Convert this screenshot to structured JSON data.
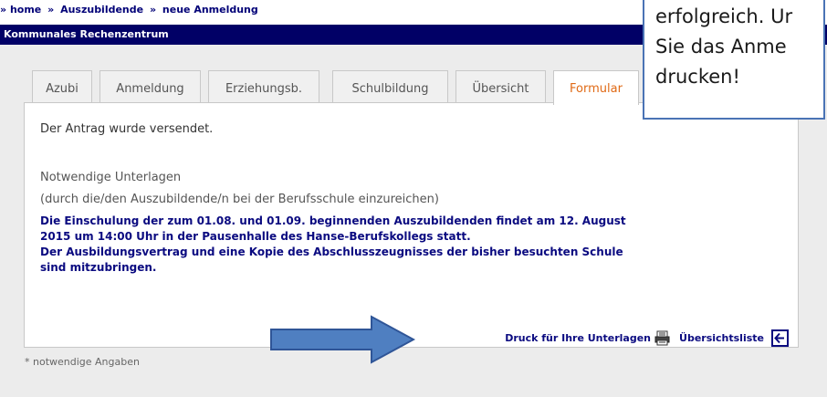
{
  "breadcrumb": {
    "prefix": "»",
    "items": [
      "home",
      "Auszubildende",
      "neue Anmeldung"
    ],
    "separator": "»"
  },
  "header": {
    "title": "Kommunales Rechenzentrum"
  },
  "tabs": [
    {
      "label": "Azubi"
    },
    {
      "label": "Anmeldung"
    },
    {
      "label": "Erziehungsb."
    },
    {
      "label": "Schulbildung"
    },
    {
      "label": "Übersicht"
    },
    {
      "label": "Formular"
    }
  ],
  "active_tab": "Formular",
  "panel": {
    "sent_message": "Der Antrag wurde versendet.",
    "required_title": "Notwendige Unterlagen",
    "required_subtitle": "(durch die/den Auszubildende/n bei der Berufsschule einzureichen)",
    "info_lines": [
      "Die Einschulung der zum 01.08. und 01.09. beginnenden Auszubildenden findet am 12. August",
      "2015 um 14:00 Uhr in der Pausenhalle des Hanse-Berufskollegs statt.",
      "Der Ausbildungsvertrag und eine Kopie des Abschlusszeugnisses der bisher besuchten Schule",
      "sind mitzubringen."
    ],
    "print_label": "Druck für Ihre Unterlagen",
    "overview_label": "Übersichtsliste"
  },
  "footnote": "* notwendige Angaben",
  "callout": {
    "lines": [
      "erfolgreich. Ur",
      "Sie das Anme",
      "drucken!"
    ]
  },
  "colors": {
    "header_bg": "#010066",
    "active_tab_text": "#e06a16",
    "info_text": "#0a0a80",
    "arrow_fill": "#4f7fc1",
    "callout_border": "#4a73b5"
  }
}
